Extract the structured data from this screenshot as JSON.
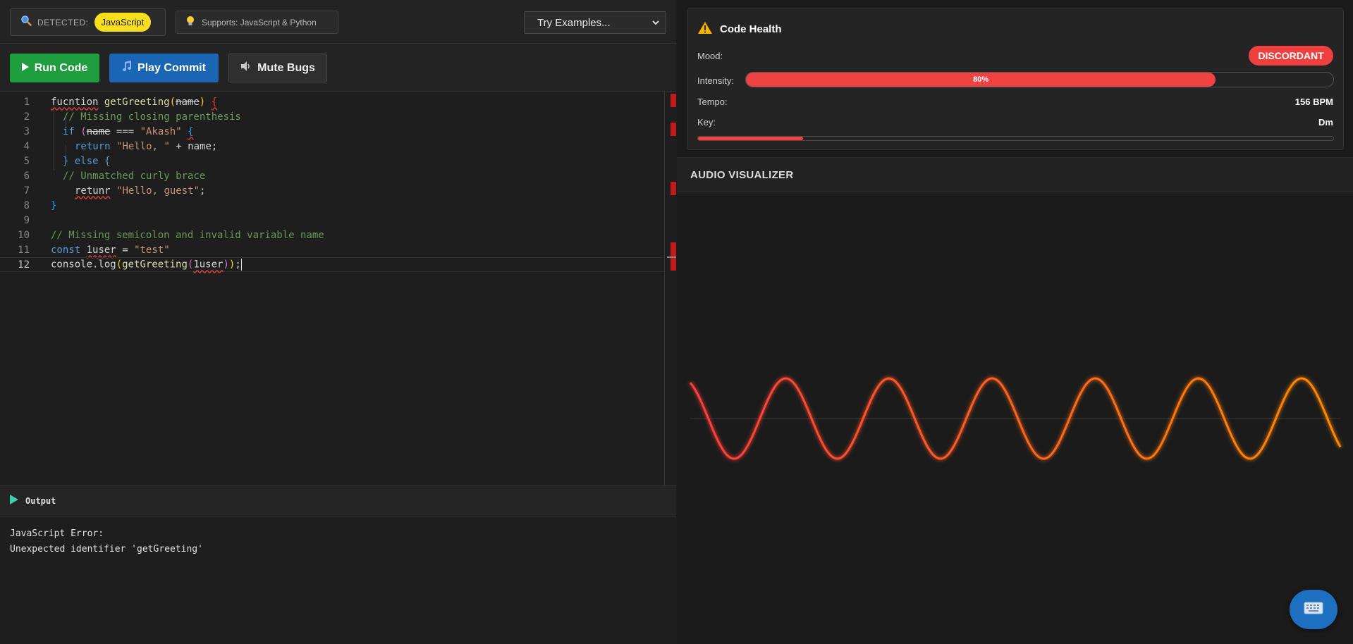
{
  "topbar": {
    "detected_label": "DETECTED:",
    "language": "JavaScript",
    "supports": "Supports: JavaScript & Python",
    "examples": "Try Examples..."
  },
  "toolbar": {
    "run": "Run Code",
    "play": "Play Commit",
    "mute": "Mute Bugs"
  },
  "editor": {
    "line_numbers": [
      "1",
      "2",
      "3",
      "4",
      "5",
      "6",
      "7",
      "8",
      "9",
      "10",
      "11",
      "12"
    ],
    "lines": [
      {
        "n": "1"
      },
      {
        "n": "2",
        "text": "// Missing closing parenthesis"
      },
      {
        "n": "3"
      },
      {
        "n": "4"
      },
      {
        "n": "5"
      },
      {
        "n": "6",
        "text": "// Unmatched curly brace"
      },
      {
        "n": "7"
      },
      {
        "n": "8",
        "text": "}"
      },
      {
        "n": "9",
        "text": ""
      },
      {
        "n": "10",
        "text": "// Missing semicolon and invalid variable name"
      },
      {
        "n": "11"
      },
      {
        "n": "12"
      }
    ],
    "tokens": {
      "l1_fn": "fucntion",
      "l1_name": "getGreeting",
      "l1_open": "(",
      "l1_param": "name",
      "l1_close": ")",
      "l1_brace": "{",
      "l3_if": "if",
      "l3_open": "(",
      "l3_name": "name",
      "l3_eq": "===",
      "l3_str": "\"Akash\"",
      "l3_brace": "{",
      "l4_ret": "return",
      "l4_str": "\"Hello, \"",
      "l4_rest": "+ name;",
      "l5_else": "} else {",
      "l7_ret": "retunr",
      "l7_str": "\"Hello, guest\"",
      "l7_semi": ";",
      "l11_const": "const",
      "l11_var": "1user",
      "l11_eq": "=",
      "l11_str": "\"test\"",
      "l12_console": "console.log",
      "l12_open": "(",
      "l12_fn": "getGreeting",
      "l12_open2": "(",
      "l12_arg": "1user",
      "l12_close2": ")",
      "l12_close": ")",
      "l12_semi": ";"
    }
  },
  "output": {
    "title": "Output",
    "line1": "JavaScript Error:",
    "line2": "Unexpected identifier 'getGreeting'"
  },
  "health": {
    "title": "Code Health",
    "mood_label": "Mood:",
    "mood": "DISCORDANT",
    "intensity_label": "Intensity:",
    "intensity_value": 0.8,
    "intensity_text": "80%",
    "tempo_label": "Tempo:",
    "tempo": "156 BPM",
    "key_label": "Key:",
    "key": "Dm",
    "key_fill": 0.165
  },
  "visualizer": {
    "title": "AUDIO VISUALIZER",
    "wave": {
      "cycles": 6.3,
      "color_start": "#ff3b3b",
      "color_end": "#ff8a00"
    }
  },
  "colors": {
    "accent_red": "#ef4242",
    "run_green": "#1e9e3e",
    "play_blue": "#1a66b5",
    "js_yellow": "#f7df1e"
  }
}
